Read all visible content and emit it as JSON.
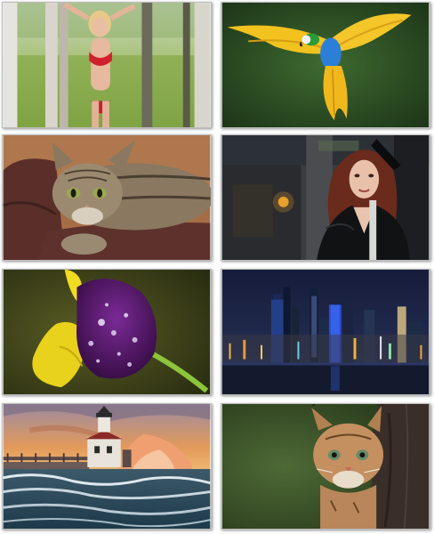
{
  "gallery": {
    "tiles": [
      {
        "subject": "woman-forest-photo"
      },
      {
        "subject": "macaw-flight-photo"
      },
      {
        "subject": "tabby-cat-photo"
      },
      {
        "subject": "woman-leather-jacket-photo"
      },
      {
        "subject": "purple-pansy-photo"
      },
      {
        "subject": "city-skyline-night-photo"
      },
      {
        "subject": "lighthouse-waves-photo"
      },
      {
        "subject": "lynx-kitten-photo"
      }
    ]
  }
}
